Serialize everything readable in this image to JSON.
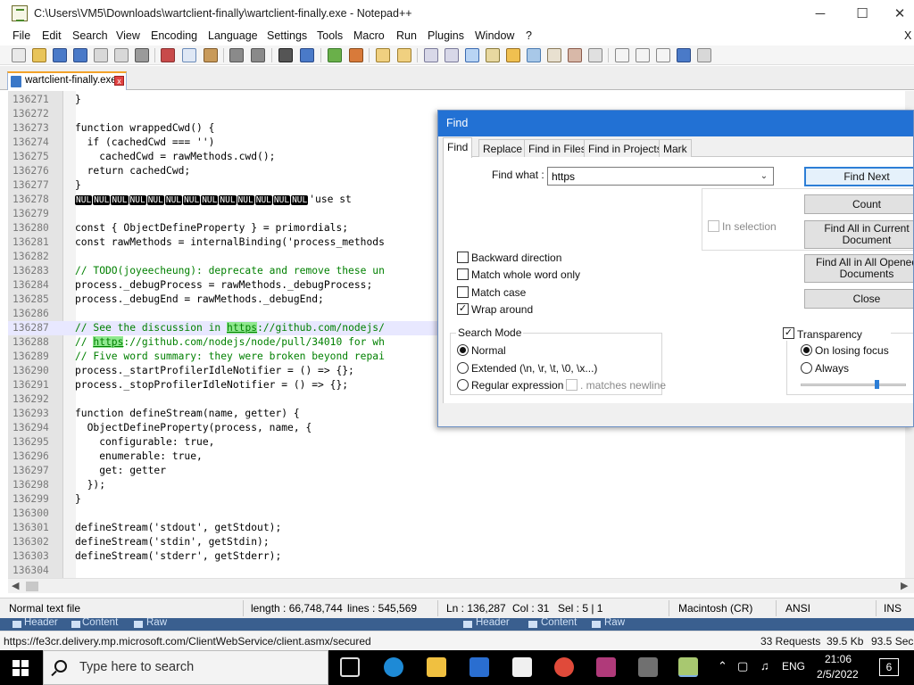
{
  "window": {
    "title": "C:\\Users\\VM5\\Downloads\\wartclient-finally\\wartclient-finally.exe - Notepad++",
    "minimize": "─",
    "maximize": "☐",
    "close": "✕"
  },
  "menu": [
    "File",
    "Edit",
    "Search",
    "View",
    "Encoding",
    "Language",
    "Settings",
    "Tools",
    "Macro",
    "Run",
    "Plugins",
    "Window",
    "?"
  ],
  "menu_close": "X",
  "tab": {
    "label": "wartclient-finally.exe",
    "close": "x"
  },
  "editor": {
    "line_numbers": [
      "136271",
      "136272",
      "136273",
      "136274",
      "136275",
      "136276",
      "136277",
      "136278",
      "136279",
      "136280",
      "136281",
      "136282",
      "136283",
      "136284",
      "136285",
      "136286",
      "136287",
      "136288",
      "136289",
      "136290",
      "136291",
      "136292",
      "136293",
      "136294",
      "136295",
      "136296",
      "136297",
      "136298",
      "136299",
      "136300",
      "136301",
      "136302",
      "136303",
      "136304"
    ],
    "lines": [
      "}",
      "",
      "function wrappedCwd() {",
      "  if (cachedCwd === '')",
      "    cachedCwd = rawMethods.cwd();",
      "  return cachedCwd;",
      "}",
      "",
      "",
      "const { ObjectDefineProperty } = primordials;",
      "const rawMethods = internalBinding('process_methods",
      "",
      "// TODO(joyeecheung): deprecate and remove these un",
      "process._debugProcess = rawMethods._debugProcess;",
      "process._debugEnd = rawMethods._debugEnd;",
      "",
      "",
      "",
      "// Five word summary: they were broken beyond repai",
      "process._startProfilerIdleNotifier = () => {};",
      "process._stopProfilerIdleNotifier = () => {};",
      "",
      "function defineStream(name, getter) {",
      "  ObjectDefineProperty(process, name, {",
      "    configurable: true,",
      "    enumerable: true,",
      "    get: getter",
      "  });",
      "}",
      "",
      "defineStream('stdout', getStdout);",
      "defineStream('stdin', getStdin);",
      "defineStream('stderr', getStderr);",
      ""
    ],
    "nul_token": "NUL",
    "nul_line_tail": "'use st",
    "see_line": {
      "prefix": "// See the discussion in ",
      "match": "https",
      "suffix": "://github.com/nodejs/"
    },
    "pr_line": {
      "prefix": "// ",
      "match": "https",
      "suffix": "://github.com/nodejs/node/pull/34010 for wh"
    }
  },
  "statusbar": {
    "type": "Normal text file",
    "length": "length : 66,748,744",
    "lines": "lines : 545,569",
    "ln": "Ln : 136,287",
    "col": "Col : 31",
    "sel": "Sel : 5 | 1",
    "eol": "Macintosh (CR)",
    "encoding": "ANSI",
    "mode": "INS"
  },
  "background_strip": {
    "left": [
      "Header",
      "Content",
      "Raw"
    ],
    "right": [
      "Header",
      "Content",
      "Raw"
    ]
  },
  "url_strip": {
    "url": "https://fe3cr.delivery.mp.microsoft.com/ClientWebService/client.asmx/secured",
    "requests": "33 Requests",
    "size": "39.5 Kb",
    "time": "93.5 Sec"
  },
  "find_dialog": {
    "title": "Find",
    "tabs": [
      "Find",
      "Replace",
      "Find in Files",
      "Find in Projects",
      "Mark"
    ],
    "find_what_label": "Find what :",
    "find_what_value": "https",
    "buttons": {
      "find_next": "Find Next",
      "count": "Count",
      "find_all_current": "Find All in Current Document",
      "find_all_opened": "Find All in All Opened Documents",
      "close": "Close"
    },
    "in_selection": "In selection",
    "options": [
      {
        "label": "Backward direction",
        "checked": false
      },
      {
        "label": "Match whole word only",
        "checked": false
      },
      {
        "label": "Match case",
        "checked": false
      },
      {
        "label": "Wrap around",
        "checked": true
      }
    ],
    "search_mode": {
      "title": "Search Mode",
      "normal": "Normal",
      "extended": "Extended (\\n, \\r, \\t, \\0, \\x...)",
      "regex": "Regular expression",
      "matches_newline": ". matches newline"
    },
    "transparency": {
      "label": "Transparency",
      "checked": true,
      "on_losing_focus": "On losing focus",
      "always": "Always",
      "level": 0.7
    }
  },
  "taskbar": {
    "search_placeholder": "Type here to search",
    "language": "ENG",
    "time": "21:06",
    "date": "2/5/2022",
    "notification_count": "6"
  },
  "colors": {
    "dialog_title": "#2271d4",
    "match_highlight": "#8fe88f",
    "tab_accent": "#f2a229"
  }
}
